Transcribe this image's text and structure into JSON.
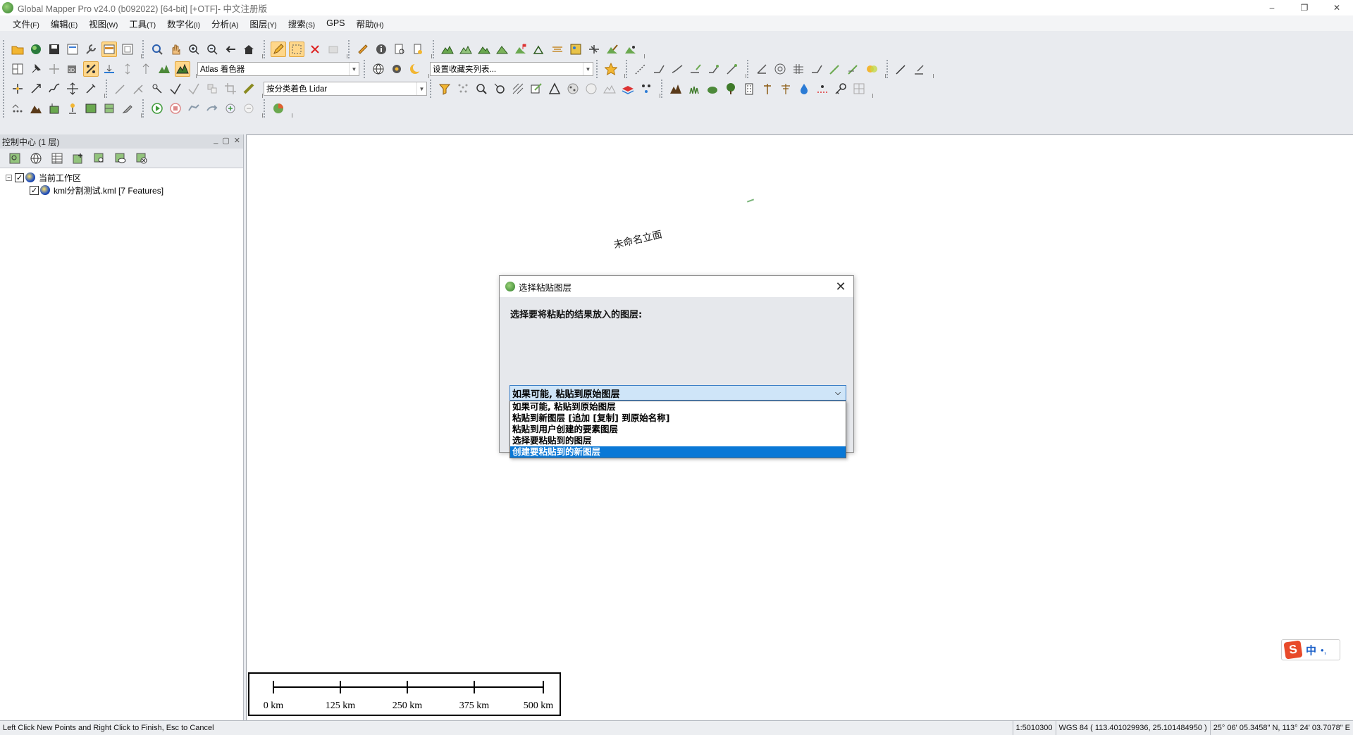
{
  "window": {
    "title": "Global Mapper Pro v24.0 (b092022) [64-bit] [+OTF]- 中文注册版",
    "controls": {
      "minimize": "–",
      "restore": "❐",
      "close": "✕"
    }
  },
  "menu": [
    {
      "label": "文件",
      "key": "(F)"
    },
    {
      "label": "编辑",
      "key": "(E)"
    },
    {
      "label": "视图",
      "key": "(W)"
    },
    {
      "label": "工具",
      "key": "(T)"
    },
    {
      "label": "数字化",
      "key": "(I)"
    },
    {
      "label": "分析",
      "key": "(A)"
    },
    {
      "label": "图层",
      "key": "(Y)"
    },
    {
      "label": "搜索",
      "key": "(S)"
    },
    {
      "label": "GPS",
      "key": ""
    },
    {
      "label": "帮助",
      "key": "(H)"
    }
  ],
  "toolbars": {
    "shader_combo": "Atlas 着色器",
    "favorites_combo": "设置收藏夹列表...",
    "lidar_combo": "按分类着色 Lidar"
  },
  "control_center": {
    "title": "控制中心 (1 层)",
    "tree": {
      "root_label": "当前工作区",
      "expander": "⊟",
      "layers": [
        {
          "label": "kml分割测试.kml [7 Features]",
          "checked": true
        }
      ]
    }
  },
  "map": {
    "label": "未命名立面",
    "scale_bar": {
      "labels": [
        "0 km",
        "125 km",
        "250 km",
        "375 km",
        "500 km"
      ]
    }
  },
  "ime": {
    "logo": "S",
    "mode": "中",
    "punct": "•,"
  },
  "status_bar": {
    "message": "Left Click New Points and Right Click to Finish, Esc to Cancel",
    "scale": "1:5010300",
    "datum": "WGS 84 ( 113.401029936, 25.101484950 )",
    "dms": "25° 06' 05.3458\" N, 113° 24' 03.7078\" E"
  },
  "dialog": {
    "title": "选择粘贴图层",
    "close": "✕",
    "prompt": "选择要将粘贴的结果放入的图层:",
    "selected_value": "如果可能, 粘贴到原始图层",
    "options": [
      "如果可能, 粘贴到原始图层",
      "粘贴到新图层 [追加 [复制] 到原始名称]",
      "粘贴到用户创建的要素图层",
      "选择要粘贴到的图层",
      "创建要粘贴到的新图层"
    ],
    "highlighted_index": 4
  },
  "colors": {
    "accent_selection": "#0a78d6",
    "active_tool": "#ffd78a",
    "panel_header": "#d9dce1"
  }
}
